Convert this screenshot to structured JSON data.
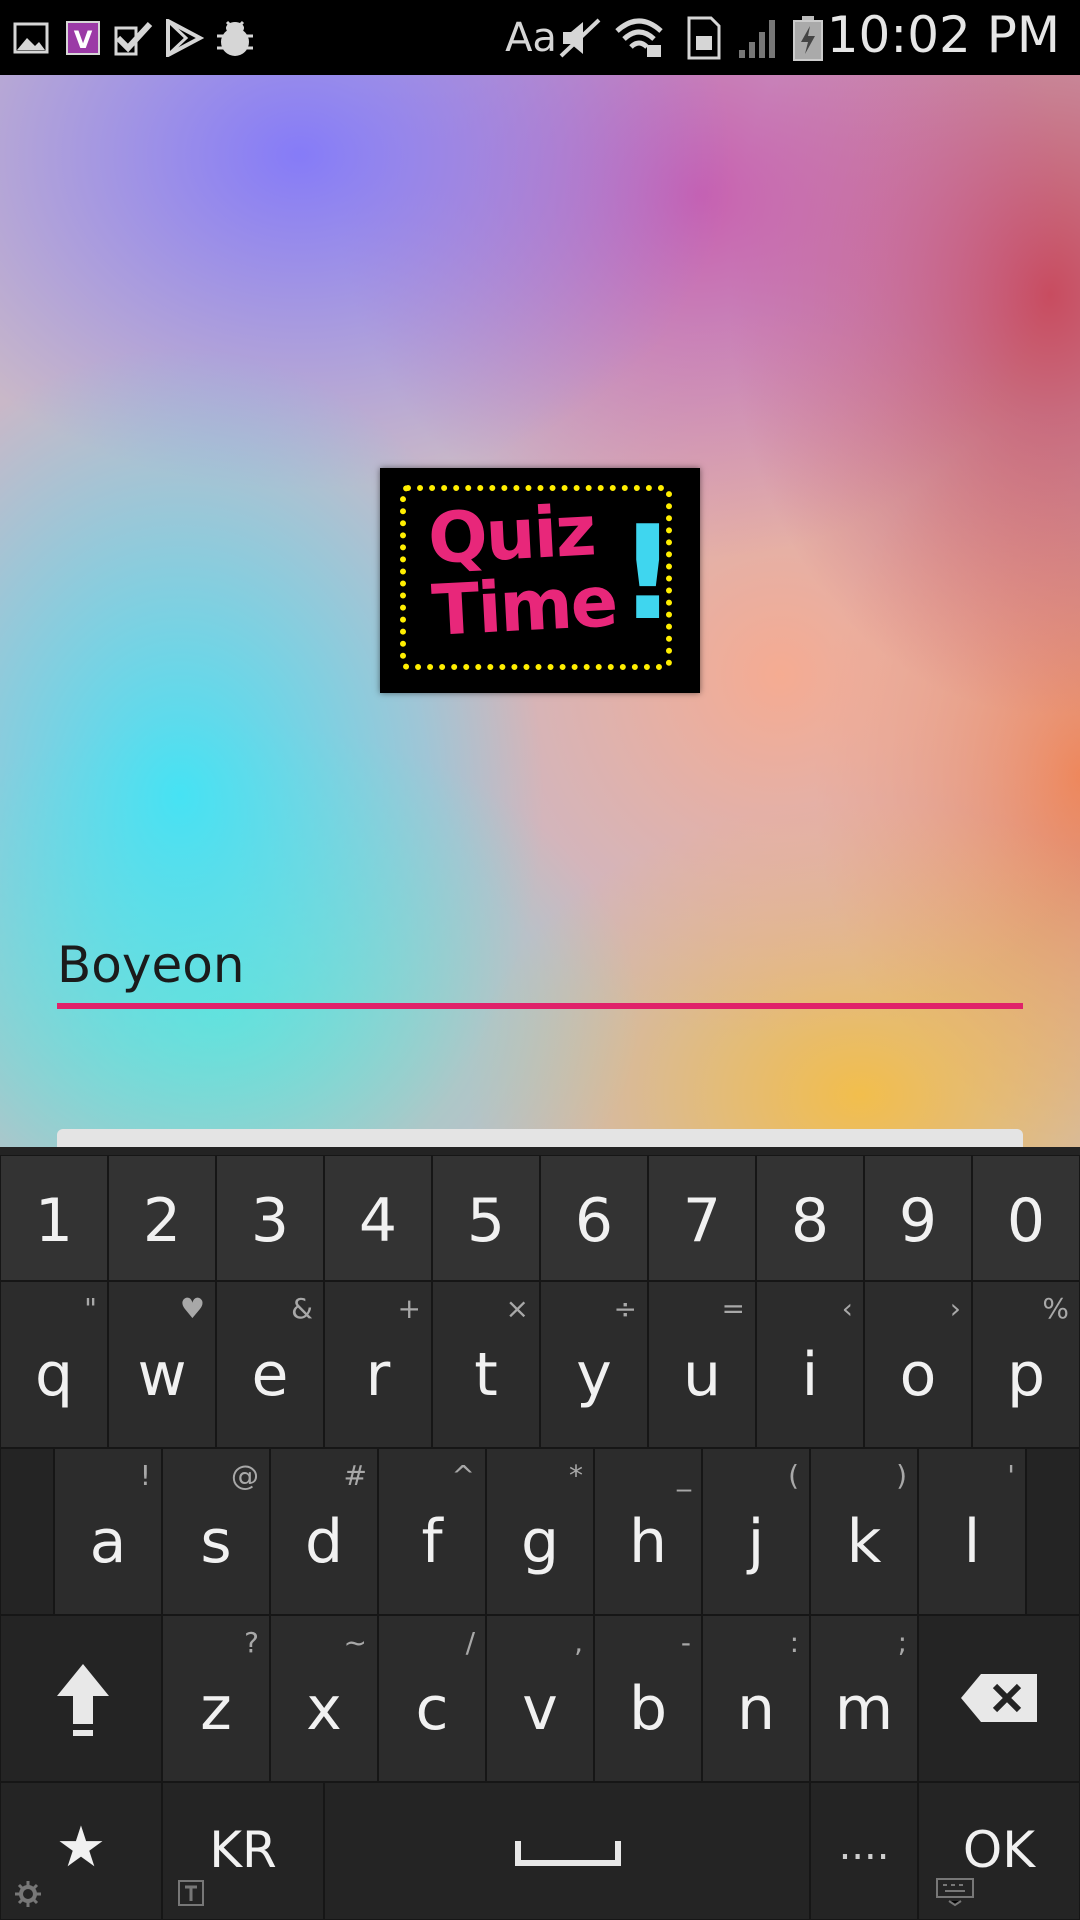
{
  "status_bar": {
    "time": "10:02 PM",
    "font_label": "Aa",
    "left_icons": [
      "gallery-icon",
      "viber-icon",
      "task-check-icon",
      "play-store-icon",
      "debug-bug-icon"
    ],
    "right_icons": [
      "mute-icon",
      "wifi-icon",
      "sim-card-icon",
      "signal-icon",
      "battery-charging-icon"
    ]
  },
  "app": {
    "logo_text_1": "Quiz",
    "logo_text_2": "Time",
    "logo_bang": "!",
    "name_value": "Boyeon",
    "accent_color": "#e0226a"
  },
  "keyboard": {
    "numbers": [
      "1",
      "2",
      "3",
      "4",
      "5",
      "6",
      "7",
      "8",
      "9",
      "0"
    ],
    "row1": [
      {
        "k": "q",
        "a": "\""
      },
      {
        "k": "w",
        "a": "♥"
      },
      {
        "k": "e",
        "a": "&"
      },
      {
        "k": "r",
        "a": "+"
      },
      {
        "k": "t",
        "a": "×"
      },
      {
        "k": "y",
        "a": "÷"
      },
      {
        "k": "u",
        "a": "="
      },
      {
        "k": "i",
        "a": "‹"
      },
      {
        "k": "o",
        "a": "›"
      },
      {
        "k": "p",
        "a": "%"
      }
    ],
    "row2": [
      {
        "k": "a",
        "a": "!"
      },
      {
        "k": "s",
        "a": "@"
      },
      {
        "k": "d",
        "a": "#"
      },
      {
        "k": "f",
        "a": "^"
      },
      {
        "k": "g",
        "a": "*"
      },
      {
        "k": "h",
        "a": "_"
      },
      {
        "k": "j",
        "a": "("
      },
      {
        "k": "k",
        "a": ")"
      },
      {
        "k": "l",
        "a": "'"
      }
    ],
    "row3": [
      {
        "k": "z",
        "a": "?"
      },
      {
        "k": "x",
        "a": "~"
      },
      {
        "k": "c",
        "a": "/"
      },
      {
        "k": "v",
        "a": ","
      },
      {
        "k": "b",
        "a": "-"
      },
      {
        "k": "n",
        "a": ":"
      },
      {
        "k": "m",
        "a": ";"
      }
    ],
    "lang_label": "KR",
    "ok_label": "OK",
    "star_label": "★",
    "period_label": "...."
  }
}
